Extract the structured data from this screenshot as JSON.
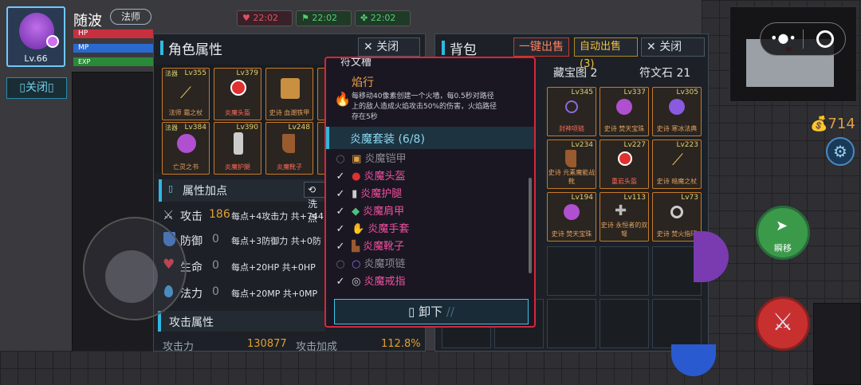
{
  "player": {
    "name": "随波",
    "class": "法师",
    "level": "Lv.66",
    "bars": {
      "hp": "HP",
      "mp": "MP",
      "exp": "EXP"
    },
    "buffs": [
      {
        "icon": "heart-icon",
        "time": "22:02",
        "color": "#e05060"
      },
      {
        "icon": "run-icon",
        "time": "22:02",
        "color": "#50d070"
      },
      {
        "icon": "clover-icon",
        "time": "22:02",
        "color": "#50d070"
      }
    ],
    "close_label": "关闭"
  },
  "character_panel": {
    "title": "角色属性",
    "close_label": "关闭",
    "equipment": [
      {
        "lv": "Lv355",
        "name": "法师 霜之杖",
        "tag": "法器",
        "icon": "staff-icon"
      },
      {
        "lv": "Lv379",
        "name": "炎魔头盔",
        "icon": "helmet-icon"
      },
      {
        "lv": "",
        "name": "史诗 血潮铁甲",
        "icon": "armor-icon"
      },
      {
        "lv": "Lv384",
        "name": "亡灵之书",
        "tag": "法器",
        "icon": "orb-icon"
      },
      {
        "lv": "Lv390",
        "name": "炎魔护腿",
        "icon": "leg-icon"
      },
      {
        "lv": "Lv248",
        "name": "炎魔靴子",
        "icon": "boot-icon"
      }
    ],
    "attr_bonus_title": "属性加点",
    "wash_label": "洗点",
    "stats": [
      {
        "icon": "sword-icon",
        "name": "攻击",
        "value": "186",
        "desc": "每点+4攻击力 共+744",
        "color": "#e0a030"
      },
      {
        "icon": "shield-icon",
        "name": "防御",
        "value": "0",
        "desc": "每点+3防御力 共+0防",
        "color": "#4a7fd0"
      },
      {
        "icon": "heart-icon",
        "name": "生命",
        "value": "0",
        "desc": "每点+20HP 共+0HP",
        "color": "#e04050"
      },
      {
        "icon": "drop-icon",
        "name": "法力",
        "value": "0",
        "desc": "每点+20MP 共+0MP",
        "color": "#4aa0e0"
      }
    ],
    "attack_attr_title": "攻击属性",
    "attack_power_label": "攻击力",
    "attack_power_value": "130877",
    "attack_bonus_label": "攻击加成",
    "attack_bonus_value": "112.8%"
  },
  "bag_panel": {
    "title": "背包",
    "sell_one_label": "一键出售",
    "auto_sell_label": "自动出售(3)",
    "close_label": "关闭",
    "tabs": [
      "藏宝图 2",
      "符文石 21"
    ],
    "items": [
      {
        "lv": "Lv345",
        "name": "封神项链",
        "icon": "necklace-icon"
      },
      {
        "lv": "Lv337",
        "name": "史诗 焚天宝珠",
        "icon": "orb-icon"
      },
      {
        "lv": "Lv305",
        "name": "史诗 寒冰法典",
        "icon": "orb-icon"
      },
      {
        "lv": "Lv234",
        "name": "史诗 元素魔能战靴",
        "icon": "boot-icon"
      },
      {
        "lv": "Lv227",
        "name": "重岩头盔",
        "icon": "helmet-icon"
      },
      {
        "lv": "Lv223",
        "name": "史诗 暗魔之杖",
        "icon": "staff-icon"
      },
      {
        "lv": "Lv194",
        "name": "史诗 焚天宝珠",
        "icon": "orb-icon"
      },
      {
        "lv": "Lv113",
        "name": "史诗 永恒者的双弩",
        "icon": "crossbow-icon"
      },
      {
        "lv": "Lv73",
        "name": "史诗 焚火指环",
        "icon": "ring-icon"
      }
    ]
  },
  "tooltip": {
    "header_partial": "符文槽",
    "skill_name": "焰行",
    "skill_desc_lines": [
      "每移动40像素创建一个火墙，每0.5秒对路径",
      "上的敌人造成火焰攻击50%的伤害，火焰路径",
      "存在5秒"
    ],
    "set_title": "炎魔套装 (6/8)",
    "set_items": [
      {
        "name": "炎魔铠甲",
        "owned": false,
        "icon": "armor-icon"
      },
      {
        "name": "炎魔头盔",
        "owned": true,
        "icon": "helmet-icon"
      },
      {
        "name": "炎魔护腿",
        "owned": true,
        "icon": "leg-icon"
      },
      {
        "name": "炎魔肩甲",
        "owned": true,
        "icon": "shoulder-icon"
      },
      {
        "name": "炎魔手套",
        "owned": true,
        "icon": "glove-icon"
      },
      {
        "name": "炎魔靴子",
        "owned": true,
        "icon": "boot-icon"
      },
      {
        "name": "炎魔项链",
        "owned": false,
        "icon": "necklace-icon"
      },
      {
        "name": "炎魔戒指",
        "owned": true,
        "icon": "ring-icon"
      }
    ],
    "unload_label": "卸下"
  },
  "hud": {
    "gold": "714",
    "dash_label": "瞬移"
  }
}
